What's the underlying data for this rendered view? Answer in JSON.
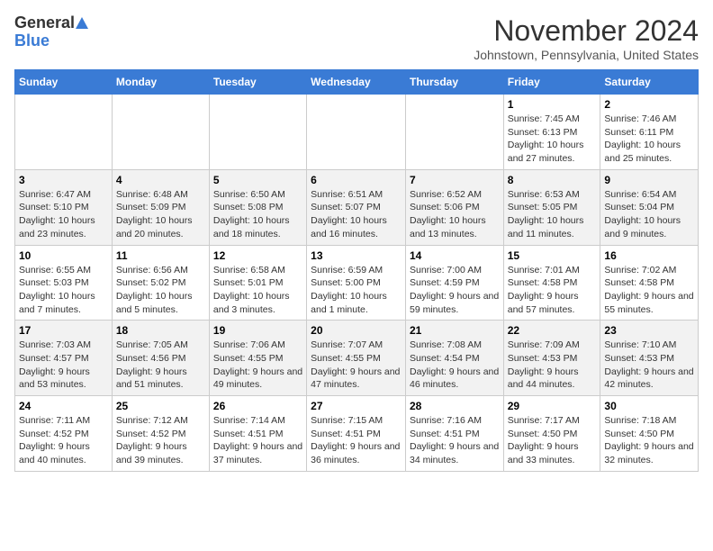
{
  "logo": {
    "line1": "General",
    "line2": "Blue"
  },
  "title": "November 2024",
  "subtitle": "Johnstown, Pennsylvania, United States",
  "days_of_week": [
    "Sunday",
    "Monday",
    "Tuesday",
    "Wednesday",
    "Thursday",
    "Friday",
    "Saturday"
  ],
  "weeks": [
    [
      {
        "day": "",
        "info": ""
      },
      {
        "day": "",
        "info": ""
      },
      {
        "day": "",
        "info": ""
      },
      {
        "day": "",
        "info": ""
      },
      {
        "day": "",
        "info": ""
      },
      {
        "day": "1",
        "info": "Sunrise: 7:45 AM\nSunset: 6:13 PM\nDaylight: 10 hours and 27 minutes."
      },
      {
        "day": "2",
        "info": "Sunrise: 7:46 AM\nSunset: 6:11 PM\nDaylight: 10 hours and 25 minutes."
      }
    ],
    [
      {
        "day": "3",
        "info": "Sunrise: 6:47 AM\nSunset: 5:10 PM\nDaylight: 10 hours and 23 minutes."
      },
      {
        "day": "4",
        "info": "Sunrise: 6:48 AM\nSunset: 5:09 PM\nDaylight: 10 hours and 20 minutes."
      },
      {
        "day": "5",
        "info": "Sunrise: 6:50 AM\nSunset: 5:08 PM\nDaylight: 10 hours and 18 minutes."
      },
      {
        "day": "6",
        "info": "Sunrise: 6:51 AM\nSunset: 5:07 PM\nDaylight: 10 hours and 16 minutes."
      },
      {
        "day": "7",
        "info": "Sunrise: 6:52 AM\nSunset: 5:06 PM\nDaylight: 10 hours and 13 minutes."
      },
      {
        "day": "8",
        "info": "Sunrise: 6:53 AM\nSunset: 5:05 PM\nDaylight: 10 hours and 11 minutes."
      },
      {
        "day": "9",
        "info": "Sunrise: 6:54 AM\nSunset: 5:04 PM\nDaylight: 10 hours and 9 minutes."
      }
    ],
    [
      {
        "day": "10",
        "info": "Sunrise: 6:55 AM\nSunset: 5:03 PM\nDaylight: 10 hours and 7 minutes."
      },
      {
        "day": "11",
        "info": "Sunrise: 6:56 AM\nSunset: 5:02 PM\nDaylight: 10 hours and 5 minutes."
      },
      {
        "day": "12",
        "info": "Sunrise: 6:58 AM\nSunset: 5:01 PM\nDaylight: 10 hours and 3 minutes."
      },
      {
        "day": "13",
        "info": "Sunrise: 6:59 AM\nSunset: 5:00 PM\nDaylight: 10 hours and 1 minute."
      },
      {
        "day": "14",
        "info": "Sunrise: 7:00 AM\nSunset: 4:59 PM\nDaylight: 9 hours and 59 minutes."
      },
      {
        "day": "15",
        "info": "Sunrise: 7:01 AM\nSunset: 4:58 PM\nDaylight: 9 hours and 57 minutes."
      },
      {
        "day": "16",
        "info": "Sunrise: 7:02 AM\nSunset: 4:58 PM\nDaylight: 9 hours and 55 minutes."
      }
    ],
    [
      {
        "day": "17",
        "info": "Sunrise: 7:03 AM\nSunset: 4:57 PM\nDaylight: 9 hours and 53 minutes."
      },
      {
        "day": "18",
        "info": "Sunrise: 7:05 AM\nSunset: 4:56 PM\nDaylight: 9 hours and 51 minutes."
      },
      {
        "day": "19",
        "info": "Sunrise: 7:06 AM\nSunset: 4:55 PM\nDaylight: 9 hours and 49 minutes."
      },
      {
        "day": "20",
        "info": "Sunrise: 7:07 AM\nSunset: 4:55 PM\nDaylight: 9 hours and 47 minutes."
      },
      {
        "day": "21",
        "info": "Sunrise: 7:08 AM\nSunset: 4:54 PM\nDaylight: 9 hours and 46 minutes."
      },
      {
        "day": "22",
        "info": "Sunrise: 7:09 AM\nSunset: 4:53 PM\nDaylight: 9 hours and 44 minutes."
      },
      {
        "day": "23",
        "info": "Sunrise: 7:10 AM\nSunset: 4:53 PM\nDaylight: 9 hours and 42 minutes."
      }
    ],
    [
      {
        "day": "24",
        "info": "Sunrise: 7:11 AM\nSunset: 4:52 PM\nDaylight: 9 hours and 40 minutes."
      },
      {
        "day": "25",
        "info": "Sunrise: 7:12 AM\nSunset: 4:52 PM\nDaylight: 9 hours and 39 minutes."
      },
      {
        "day": "26",
        "info": "Sunrise: 7:14 AM\nSunset: 4:51 PM\nDaylight: 9 hours and 37 minutes."
      },
      {
        "day": "27",
        "info": "Sunrise: 7:15 AM\nSunset: 4:51 PM\nDaylight: 9 hours and 36 minutes."
      },
      {
        "day": "28",
        "info": "Sunrise: 7:16 AM\nSunset: 4:51 PM\nDaylight: 9 hours and 34 minutes."
      },
      {
        "day": "29",
        "info": "Sunrise: 7:17 AM\nSunset: 4:50 PM\nDaylight: 9 hours and 33 minutes."
      },
      {
        "day": "30",
        "info": "Sunrise: 7:18 AM\nSunset: 4:50 PM\nDaylight: 9 hours and 32 minutes."
      }
    ]
  ]
}
